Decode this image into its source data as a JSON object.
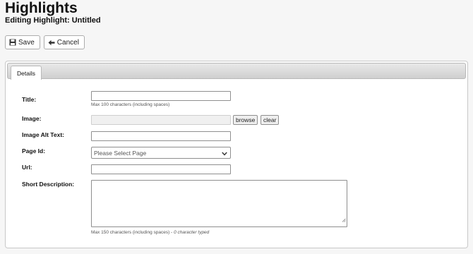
{
  "header": {
    "title": "Highlights",
    "subtitle": "Editing Highlight: Untitled"
  },
  "toolbar": {
    "save_label": "Save",
    "save_icon": "save-icon",
    "cancel_label": "Cancel",
    "cancel_icon": "arrow-left-icon"
  },
  "tabs": [
    {
      "label": "Details",
      "active": true
    }
  ],
  "form": {
    "title_label": "Title:",
    "title_value": "",
    "title_hint": "Max 100 characters (including spaces)",
    "image_label": "Image:",
    "image_value": "",
    "browse_label": "browse",
    "clear_label": "clear",
    "alt_label": "Image Alt Text:",
    "alt_value": "",
    "page_label": "Page Id:",
    "page_selected": "Please Select Page",
    "url_label": "Url:",
    "url_value": "",
    "desc_label": "Short Description:",
    "desc_value": "",
    "desc_hint": "Max 150 characters (including spaces) - ",
    "desc_count": "0 character typed"
  }
}
